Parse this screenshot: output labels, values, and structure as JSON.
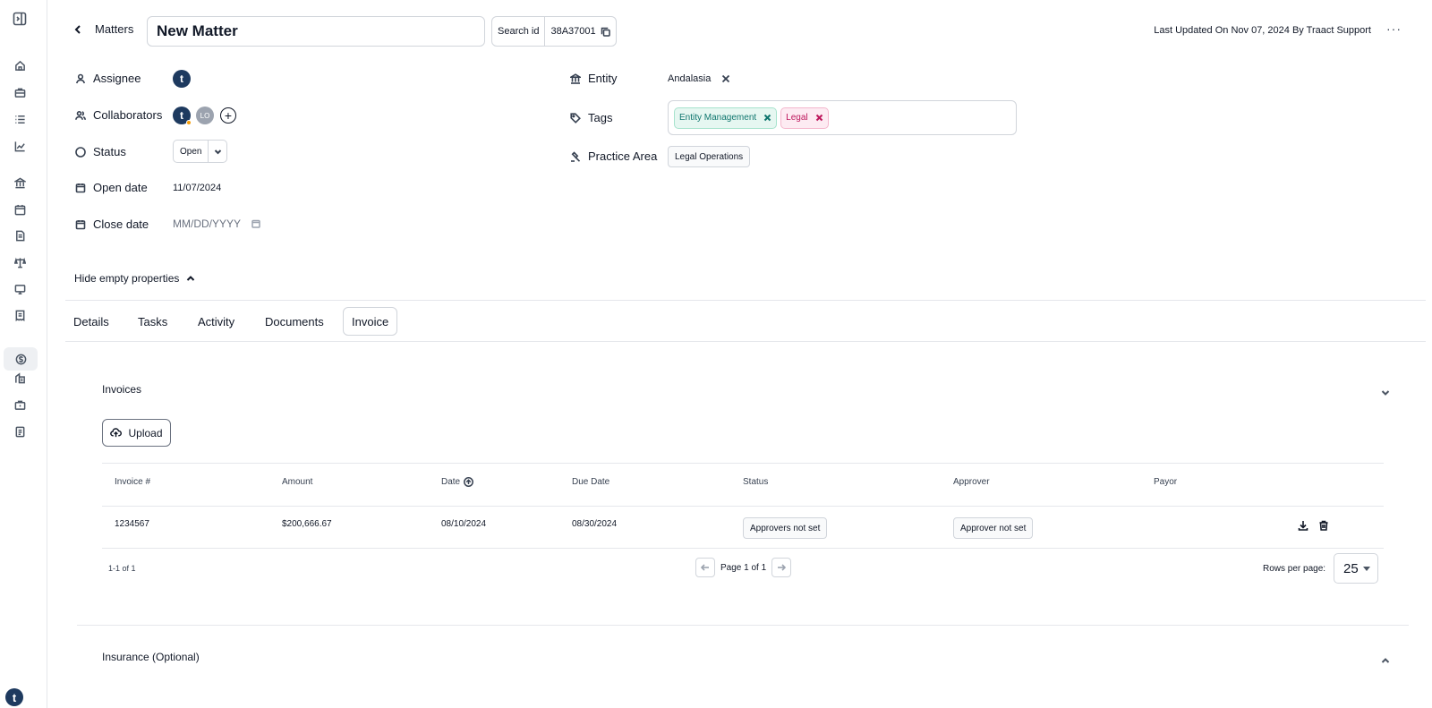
{
  "header": {
    "back_label": "Matters",
    "title": "New Matter",
    "search_id_label": "Search id",
    "search_id_value": "38A37001",
    "last_updated": "Last Updated On Nov 07, 2024 By Traact Support",
    "more": "···"
  },
  "sidebar": {
    "logo": "t",
    "items": [
      "sidebar-toggle-icon",
      "home-icon",
      "briefcase-icon",
      "list-icon",
      "chart-icon",
      "bank-icon",
      "calendar-icon",
      "document-icon",
      "scale-icon",
      "monitor-icon",
      "receipt-icon",
      "dollar-icon",
      "building-icon",
      "case-icon",
      "file-icon"
    ]
  },
  "properties": {
    "assignee_label": "Assignee",
    "assignee_avatar": "t",
    "collaborators_label": "Collaborators",
    "collaborator_avatar_1": "t",
    "collaborator_avatar_2": "LO",
    "add_collaborator": "+",
    "status_label": "Status",
    "status_value": "Open",
    "open_date_label": "Open date",
    "open_date_value": "11/07/2024",
    "close_date_label": "Close date",
    "close_date_placeholder": "MM/DD/YYYY",
    "entity_label": "Entity",
    "entity_value": "Andalasia",
    "tags_label": "Tags",
    "tags": [
      "Entity Management",
      "Legal"
    ],
    "practice_area_label": "Practice Area",
    "practice_area_value": "Legal Operations",
    "hide_empty": "Hide empty properties"
  },
  "tabs": [
    {
      "label": "Details"
    },
    {
      "label": "Tasks"
    },
    {
      "label": "Activity"
    },
    {
      "label": "Documents"
    },
    {
      "label": "Invoice"
    }
  ],
  "active_tab": "Invoice",
  "invoices": {
    "title": "Invoices",
    "upload_label": "Upload",
    "columns": [
      "Invoice #",
      "Amount",
      "Date",
      "Due Date",
      "Status",
      "Approver",
      "Payor"
    ],
    "rows": [
      {
        "invoice": "1234567",
        "amount": "$200,666.67",
        "date": "08/10/2024",
        "due_date": "08/30/2024",
        "status": "Approvers not set",
        "approver": "Approver not set",
        "payor": ""
      }
    ],
    "count": "1-1 of 1",
    "page": "Page 1 of 1",
    "rows_per_page_label": "Rows per page:",
    "rows_per_page_value": "25"
  },
  "insurance": {
    "title": "Insurance (Optional)"
  },
  "colors": {
    "brand": "#1e3a5f",
    "tag_green": "#0f766e",
    "tag_pink": "#be185d"
  }
}
